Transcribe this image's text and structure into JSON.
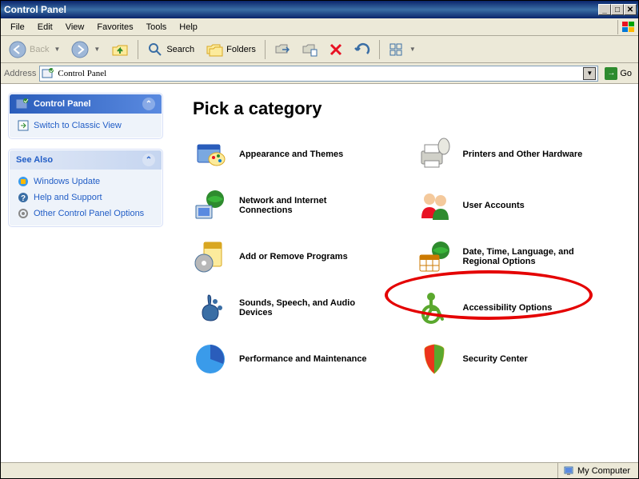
{
  "window": {
    "title": "Control Panel"
  },
  "menubar": {
    "items": [
      "File",
      "Edit",
      "View",
      "Favorites",
      "Tools",
      "Help"
    ]
  },
  "toolbar": {
    "back": "Back",
    "search": "Search",
    "folders": "Folders"
  },
  "addressbar": {
    "label": "Address",
    "value": "Control Panel",
    "go": "Go"
  },
  "sidebar": {
    "panel1": {
      "title": "Control Panel",
      "links": [
        {
          "icon": "switch-view-icon",
          "label": "Switch to Classic View"
        }
      ]
    },
    "panel2": {
      "title": "See Also",
      "links": [
        {
          "icon": "windows-update-icon",
          "label": "Windows Update"
        },
        {
          "icon": "help-icon",
          "label": "Help and Support"
        },
        {
          "icon": "settings-icon",
          "label": "Other Control Panel Options"
        }
      ]
    }
  },
  "main": {
    "heading": "Pick a category",
    "categories": [
      {
        "icon": "appearance-themes-icon",
        "label": "Appearance and Themes"
      },
      {
        "icon": "printers-hardware-icon",
        "label": "Printers and Other Hardware"
      },
      {
        "icon": "network-icon",
        "label": "Network and Internet Connections"
      },
      {
        "icon": "user-accounts-icon",
        "label": "User Accounts"
      },
      {
        "icon": "add-remove-programs-icon",
        "label": "Add or Remove Programs"
      },
      {
        "icon": "date-time-language-icon",
        "label": "Date, Time, Language, and Regional Options",
        "highlighted": true
      },
      {
        "icon": "sounds-speech-icon",
        "label": "Sounds, Speech, and Audio Devices"
      },
      {
        "icon": "accessibility-icon",
        "label": "Accessibility Options"
      },
      {
        "icon": "performance-icon",
        "label": "Performance and Maintenance"
      },
      {
        "icon": "security-center-icon",
        "label": "Security Center"
      }
    ]
  },
  "statusbar": {
    "text": "My Computer"
  }
}
